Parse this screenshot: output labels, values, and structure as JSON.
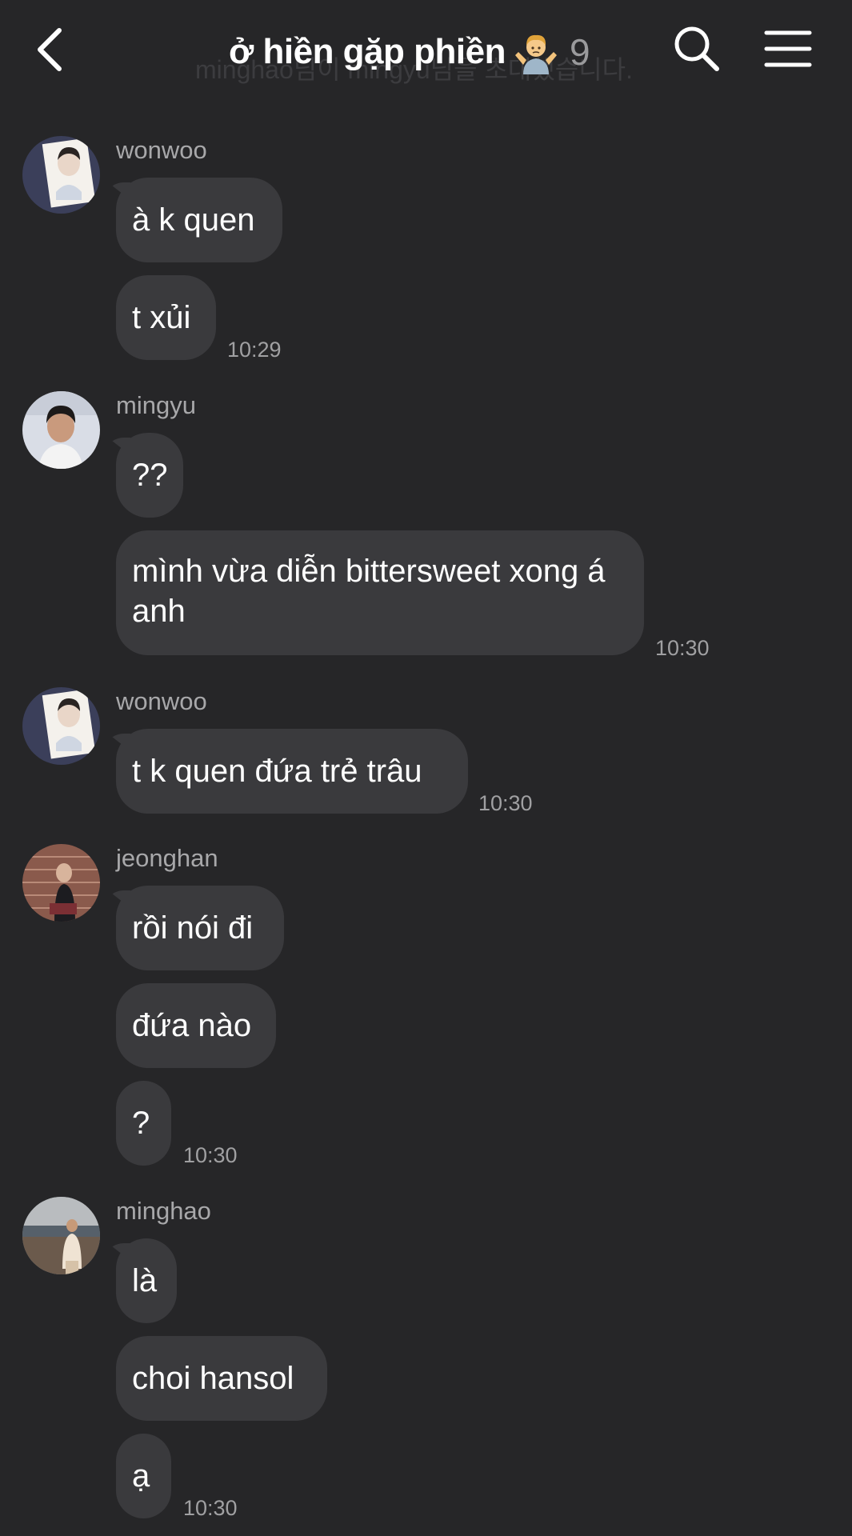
{
  "header": {
    "title": "ở hiền gặp phiền",
    "member_count": "9",
    "ghost_notice": "minghao님이 mingyu님을 초대했습니다."
  },
  "groups": [
    {
      "sender": "wonwoo",
      "messages": [
        "à k quen",
        "t xủi"
      ],
      "time": "10:29"
    },
    {
      "sender": "mingyu",
      "messages": [
        "??",
        "mình vừa diễn bittersweet xong á anh"
      ],
      "time": "10:30"
    },
    {
      "sender": "wonwoo",
      "messages": [
        "t k quen đứa trẻ trâu"
      ],
      "time": "10:30"
    },
    {
      "sender": "jeonghan",
      "messages": [
        "rồi nói đi",
        "đứa nào",
        "?"
      ],
      "time": "10:30"
    },
    {
      "sender": "minghao",
      "messages": [
        "là",
        "choi hansol",
        "ạ"
      ],
      "time": "10:30"
    }
  ],
  "colors": {
    "background": "#262628",
    "bubble": "#3a3a3d",
    "sender_text": "#a8a8aa",
    "time_text": "#a0a0a2"
  },
  "icons": {
    "back": "chevron-left-icon",
    "search": "search-icon",
    "menu": "hamburger-menu-icon",
    "title_emoji": "person-shrugging-emoji"
  }
}
